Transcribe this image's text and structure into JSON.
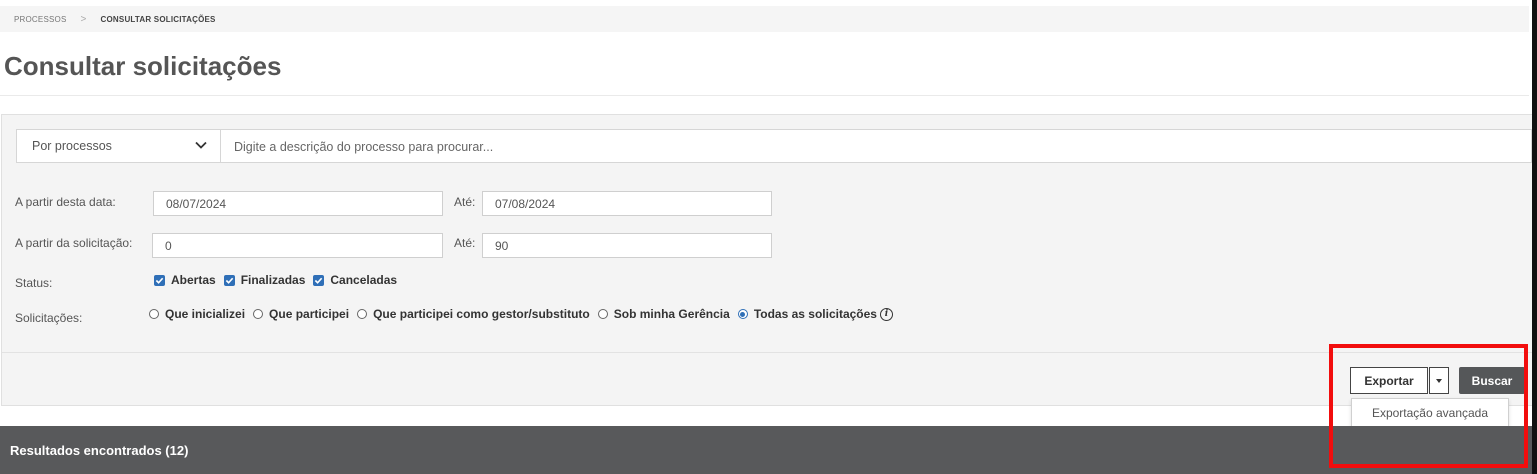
{
  "breadcrumb": {
    "parent": "PROCESSOS",
    "separator": ">",
    "current": "CONSULTAR SOLICITAÇÕES"
  },
  "page": {
    "title": "Consultar solicitações"
  },
  "search": {
    "mode_selected": "Por processos",
    "placeholder": "Digite a descrição do processo para procurar..."
  },
  "filters": {
    "date_from_label": "A partir desta data:",
    "date_from_value": "08/07/2024",
    "date_to_label": "Até:",
    "date_to_value": "07/08/2024",
    "req_from_label": "A partir da solicitação:",
    "req_from_value": "0",
    "req_to_label": "Até:",
    "req_to_value": "90",
    "status_label": "Status:",
    "status_options": [
      {
        "label": "Abertas",
        "checked": true
      },
      {
        "label": "Finalizadas",
        "checked": true
      },
      {
        "label": "Canceladas",
        "checked": true
      }
    ],
    "requests_label": "Solicitações:",
    "requests_options": [
      {
        "label": "Que inicializei",
        "selected": false
      },
      {
        "label": "Que participei",
        "selected": false
      },
      {
        "label": "Que participei como gestor/substituto",
        "selected": false
      },
      {
        "label": "Sob minha Gerência",
        "selected": false
      },
      {
        "label": "Todas as solicitações",
        "selected": true
      }
    ]
  },
  "actions": {
    "export_label": "Exportar",
    "search_label": "Buscar",
    "export_menu": [
      "Exportação avançada"
    ]
  },
  "results": {
    "header": "Resultados encontrados (12)"
  },
  "colors": {
    "accent": "#2f6fb7",
    "results_bar": "#58595b",
    "highlight": "#f20d0d",
    "primary_button": "#555759"
  }
}
